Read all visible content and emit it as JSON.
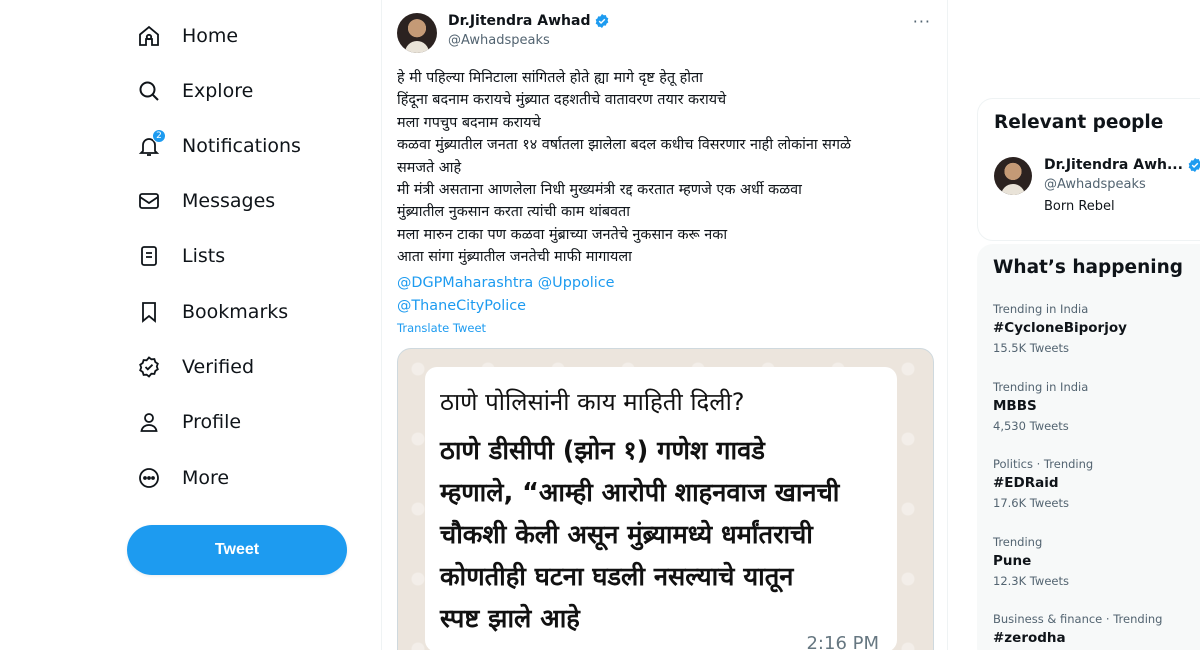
{
  "nav": {
    "items": [
      {
        "label": "Home",
        "icon": "home-icon"
      },
      {
        "label": "Explore",
        "icon": "search-icon"
      },
      {
        "label": "Notifications",
        "icon": "bell-icon",
        "badge": "2"
      },
      {
        "label": "Messages",
        "icon": "envelope-icon"
      },
      {
        "label": "Lists",
        "icon": "list-icon"
      },
      {
        "label": "Bookmarks",
        "icon": "bookmark-icon"
      },
      {
        "label": "Verified",
        "icon": "verified-badge-icon"
      },
      {
        "label": "Profile",
        "icon": "person-icon"
      },
      {
        "label": "More",
        "icon": "more-circle-icon"
      }
    ],
    "tweet_button": "Tweet"
  },
  "tweet": {
    "author_name": "Dr.Jitendra Awhad",
    "handle": "@Awhadspeaks",
    "more": "···",
    "lines": [
      "हे मी पहिल्या मिनिटाला सांगितले होते ह्या मागे दृष्ट हेतू होता",
      "हिंदूना बदनाम करायचे मुंब्र्यात दहशतीचे वातावरण तयार करायचे",
      "मला गपचुप बदनाम करायचे",
      "कळवा मुंब्र्यातील जनता १४ वर्षातला झालेला बदल कधीच विसरणार नाही लोकांना सगळे",
      "समजते आहे",
      "मी मंत्री असताना आणलेला निधी मुख्यमंत्री रद्द करतात म्हणजे एक अर्धी कळवा",
      "मुंब्र्यातील नुकसान करता त्यांची काम थांबवता",
      "मला मारुन टाका पण कळवा मुंब्राच्या जनतेचे नुकसान करू नका",
      "आता सांगा मुंब्र्यातील जनतेची माफी मागायला"
    ],
    "mention_line_1": "@DGPMaharashtra @Uppolice",
    "mention_line_2": "@ThaneCityPolice",
    "translate": "Translate Tweet",
    "media": {
      "question": "ठाणे पोलिसांनी काय माहिती दिली?",
      "bold_lines": [
        "ठाणे डीसीपी (झोन १) गणेश गावडे",
        "म्हणाले, “आम्ही आरोपी शाहनवाज खानची",
        "चौकशी केली असून मुंब्र्यामध्ये धर्मांतराची",
        "कोणतीही घटना घडली नसल्याचे यातून",
        "स्पष्ट झाले आहे"
      ],
      "time": "2:16 PM"
    }
  },
  "relevant": {
    "title": "Relevant people",
    "name": "Dr.Jitendra Awh...",
    "handle": "@Awhadspeaks",
    "bio": "Born Rebel"
  },
  "happening": {
    "title": "What’s happening",
    "trends": [
      {
        "context": "Trending in India",
        "name": "#CycloneBiporjoy",
        "count": "15.5K Tweets"
      },
      {
        "context": "Trending in India",
        "name": "MBBS",
        "count": "4,530 Tweets"
      },
      {
        "context": "Politics · Trending",
        "name": "#EDRaid",
        "count": "17.6K Tweets"
      },
      {
        "context": "Trending",
        "name": "Pune",
        "count": "12.3K Tweets"
      },
      {
        "context": "Business & finance · Trending",
        "name": "#zerodha",
        "count": ""
      }
    ]
  },
  "colors": {
    "accent": "#1d9bf0",
    "text": "#0f1419",
    "muted": "#536471"
  }
}
